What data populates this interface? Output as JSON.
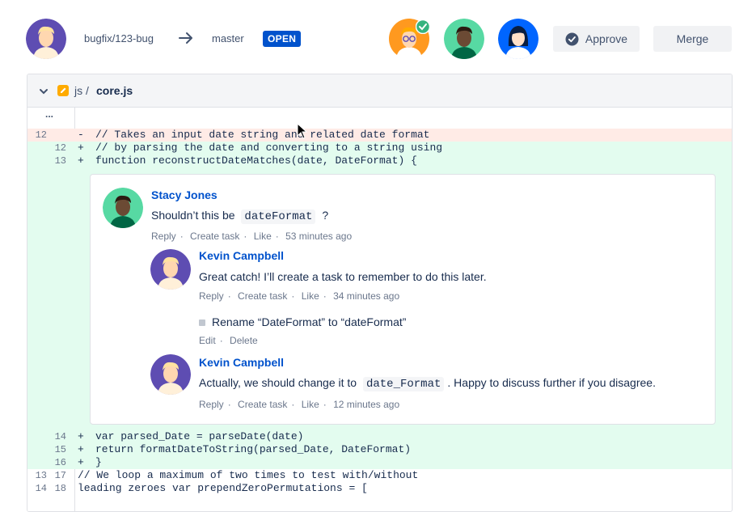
{
  "header": {
    "source_branch": "bugfix/123-bug",
    "target_branch": "master",
    "status": "OPEN",
    "approve_label": "Approve",
    "merge_label": "Merge"
  },
  "file": {
    "folder": "js /",
    "name": "core.js",
    "collapsed_marker": "..."
  },
  "lines": [
    {
      "old": "12",
      "new": "",
      "sign": "-",
      "text": "// Takes an input date string and related date format",
      "type": "removed"
    },
    {
      "old": "",
      "new": "12",
      "sign": "+",
      "text": "// by parsing the date and converting to a string using",
      "type": "added"
    },
    {
      "old": "",
      "new": "13",
      "sign": "+",
      "text": "function reconstructDateMatches(date, DateFormat) {",
      "type": "added"
    }
  ],
  "lines_after": [
    {
      "old": "",
      "new": "14",
      "sign": "+",
      "text": "var parsed_Date = parseDate(date)",
      "type": "added"
    },
    {
      "old": "",
      "new": "15",
      "sign": "+",
      "text": "return formatDateToString(parsed_Date, DateFormat)",
      "type": "added"
    },
    {
      "old": "",
      "new": "16",
      "sign": "+",
      "text": "}",
      "type": "added"
    },
    {
      "old": "13",
      "new": "17",
      "sign": "",
      "text": "// We loop a maximum of two times to test with/without",
      "type": "context"
    },
    {
      "old": "14",
      "new": "18",
      "sign": "",
      "text": "leading zeroes var prependZeroPermutations = [",
      "type": "context"
    }
  ],
  "comments": [
    {
      "author": "Stacy Jones",
      "text_before": "Shouldn’t this be",
      "code": "dateFormat",
      "text_after": "?",
      "actions": [
        "Reply",
        "Create task",
        "Like"
      ],
      "time": "53 minutes ago"
    },
    {
      "author": "Kevin Campbell",
      "text": "Great catch! I’ll create a task to remember to do this later.",
      "actions": [
        "Reply",
        "Create task",
        "Like"
      ],
      "time": "34 minutes ago",
      "task": {
        "text": "Rename “DateFormat” to “dateFormat”",
        "actions": [
          "Edit",
          "Delete"
        ]
      }
    },
    {
      "author": "Kevin Campbell",
      "text_before": "Actually, we should change it to",
      "code": "date_Format",
      "text_after": ". Happy to discuss further if you disagree.",
      "actions": [
        "Reply",
        "Create task",
        "Like"
      ],
      "time": "12 minutes ago"
    }
  ],
  "colors": {
    "accent": "#0052cc",
    "removed_bg": "#ffebe6",
    "added_bg": "#e3fcef",
    "approved_check": "#36b37e"
  }
}
